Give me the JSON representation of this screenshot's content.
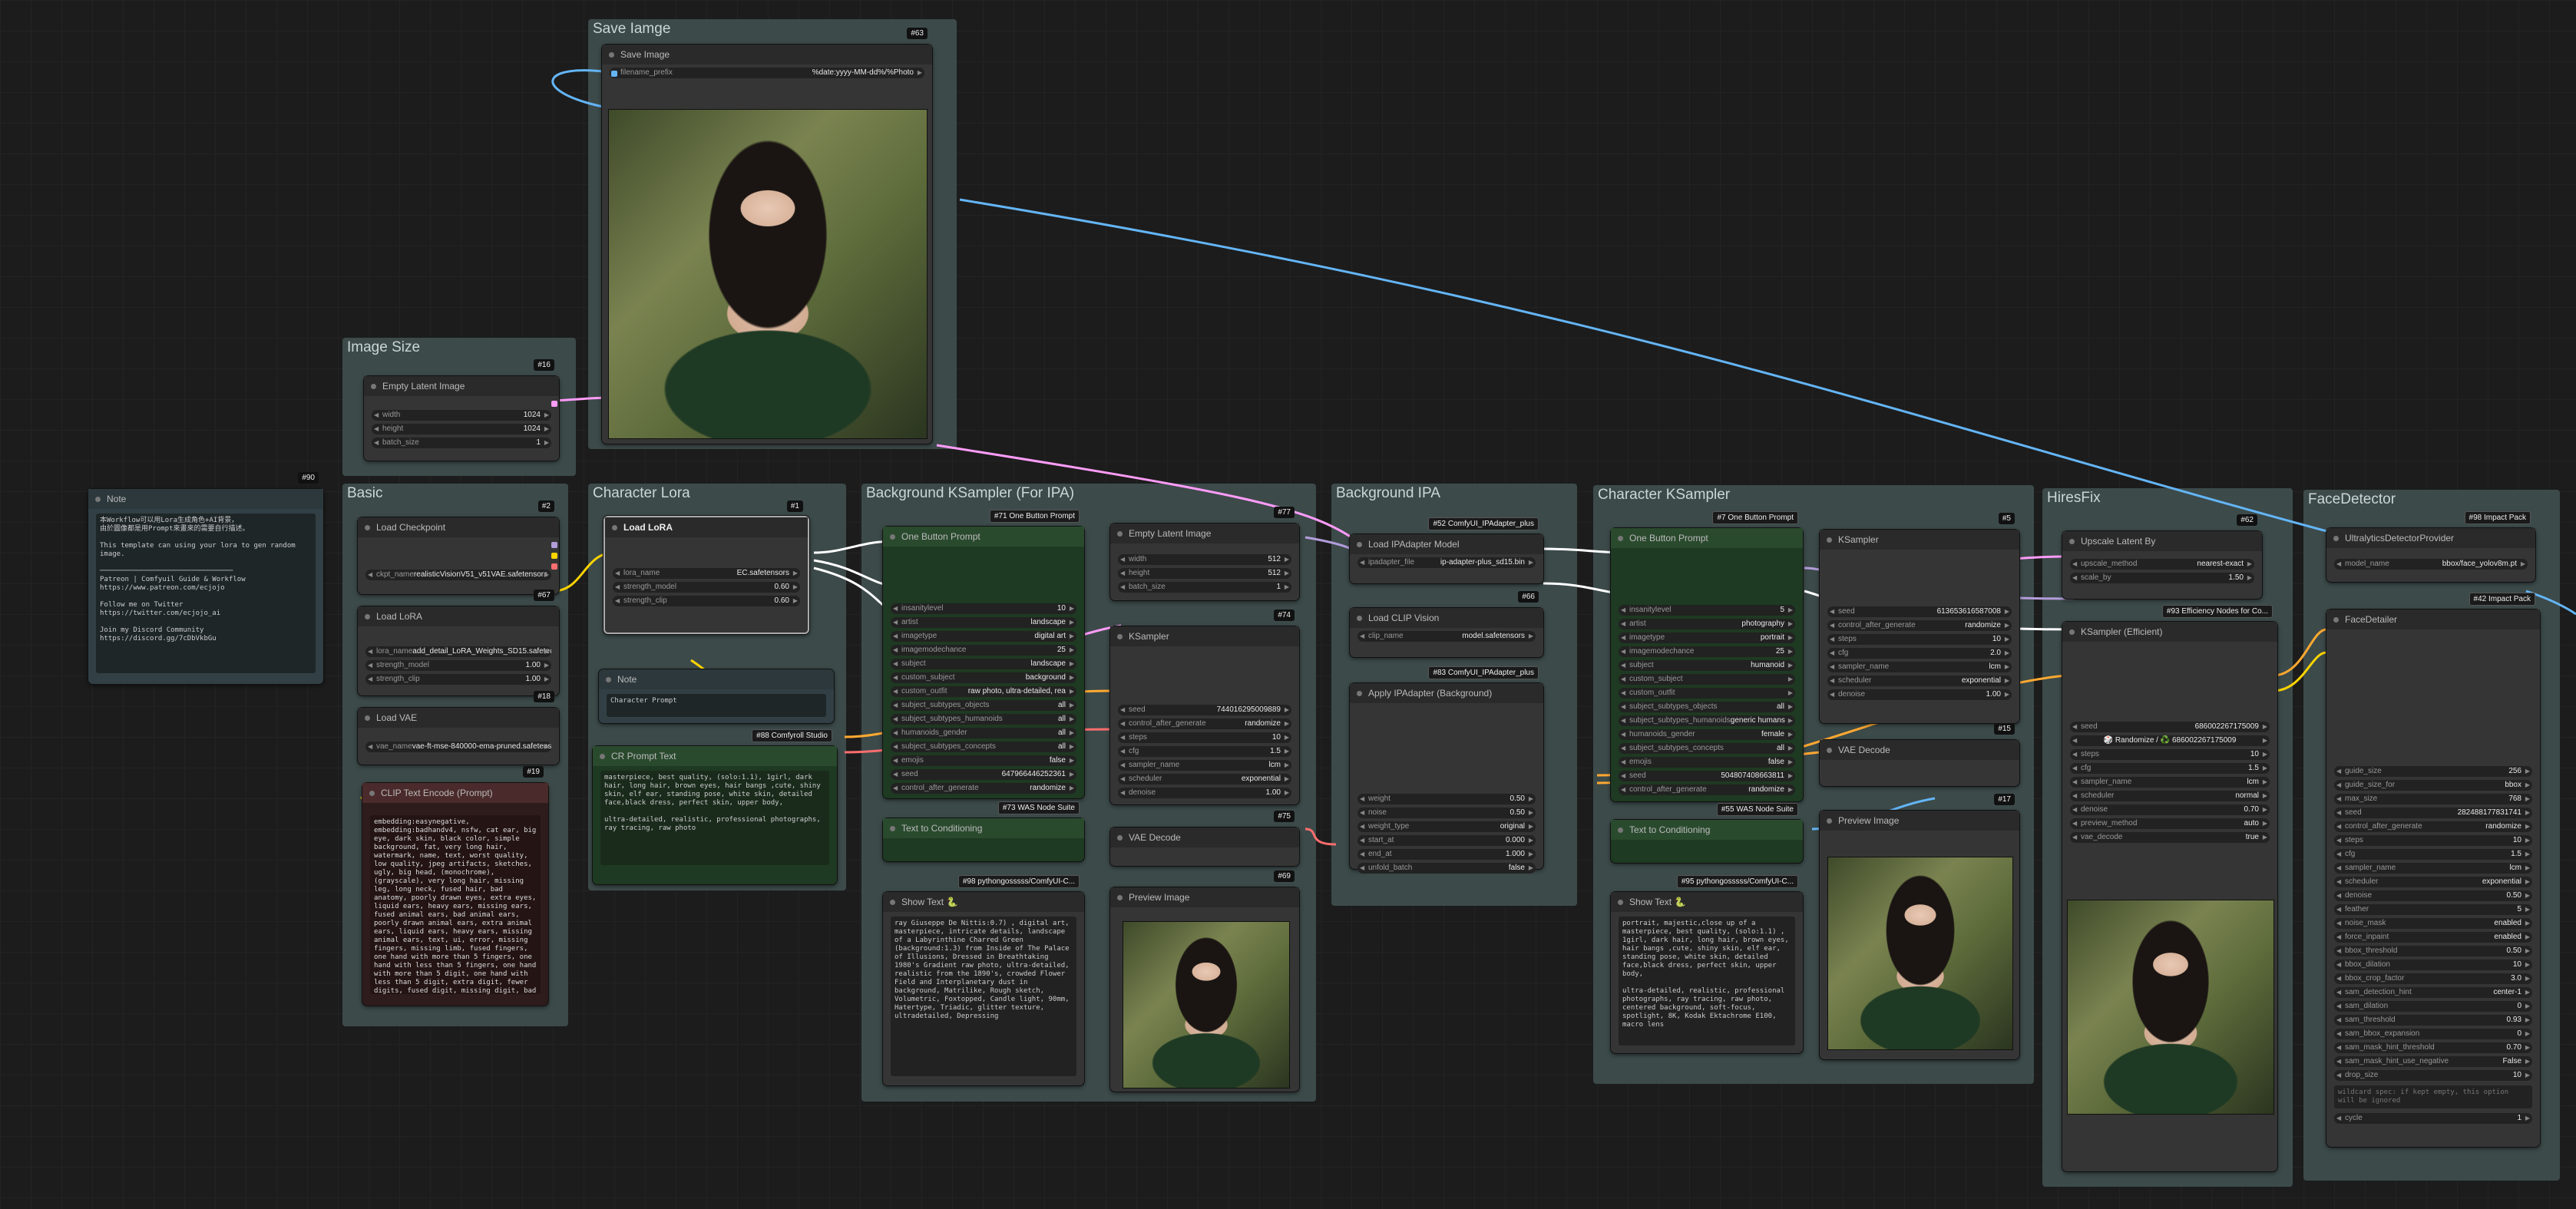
{
  "groups": {
    "save_image": "Save Iamge",
    "image_size": "Image Size",
    "basic": "Basic",
    "character_lora": "Character Lora",
    "bg_ksampler": "Background KSampler (For IPA)",
    "bg_ipa": "Background IPA",
    "char_ksampler": "Character KSampler",
    "hiresfix": "HiresFix",
    "facedetector": "FaceDetector"
  },
  "save_image_node": {
    "title": "Save Image",
    "badge": "#63",
    "filename_label": "filename_prefix",
    "filename_value": "%date:yyyy-MM-dd%/%Photo"
  },
  "empty_latent_1": {
    "title": "Empty Latent Image",
    "badge": "#16",
    "width_label": "width",
    "width": "1024",
    "height_label": "height",
    "height": "1024",
    "batch_label": "batch_size",
    "batch": "1"
  },
  "note_main": {
    "title": "Note",
    "badge": "#90",
    "text": "本Workflow可以用Lora生成角色+AI背景，\n由於圖像都是用Prompt來畫來的需要自行描述。\n\nThis template can using your lora to gen random image.\n\n────────────────────────────────\nPatreon | Comfyuil Guide & Workflow\nhttps://www.patreon.com/ecjojo\n\nFollow me on Twitter\nhttps://twitter.com/ecjojo_ai\n\nJoin my Discord Community\nhttps://discord.gg/7cDbVkbGu"
  },
  "load_checkpoint": {
    "title": "Load Checkpoint",
    "badge": "#2",
    "ckpt_label": "ckpt_name",
    "ckpt": "realisticVisionV51_v51VAE.safetensors"
  },
  "load_lora_basic": {
    "title": "Load LoRA",
    "badge": "#67",
    "lora_label": "lora_name",
    "lora": "add_detail_LoRA_Weights_SD15.safetensors",
    "sm_label": "strength_model",
    "sm": "1.00",
    "sc_label": "strength_clip",
    "sc": "1.00"
  },
  "load_vae": {
    "title": "Load VAE",
    "badge": "#18",
    "vae_label": "vae_name",
    "vae": "vae-ft-mse-840000-ema-pruned.safetensors"
  },
  "clip_text_encode": {
    "title": "CLIP Text Encode (Prompt)",
    "badge": "#19",
    "text": "embedding:easynegative, embedding:badhandv4, nsfw, cat ear, big eye, dark skin, black color, simple background, fat, very long hair, watermark, name, text, worst quality, low quality, jpeg artifacts, sketches, ugly, big head, (monochrome), (grayscale), very long hair, missing leg, long neck, fused hair, bad anatomy, poorly drawn eyes, extra eyes, liquid ears, heavy ears, missing ears, fused animal ears, bad animal ears, poorly drawn animal ears, extra animal ears, liquid ears, heavy ears, missing animal ears, text, ui, error, missing fingers, missing limb, fused fingers, one hand with more than 5 fingers, one hand with less than 5 fingers, one hand with more than 5 digit, one hand with less than 5 digit, extra digit, fewer digits, fused digit, missing digit, bad digit, liquid digit, colorful tongue, black tongue, cropped, watermark, username, blurry, JPEG artifacts, signature, 3D, 3D game, 3D game scene, 3D character, malformed feet, extra feet, bad feet, poorly drawn feet, fused feet, missing feet, extra shoes, bad shoes, fused shoes, more than two shoes, poorly drawn shoes, bad gloves, poorly drawn gloves, fused gloves, bad cum, poorly drawn cum, fused cum, bad hairs, poorly drawn hairs, fused hairs, big muscles, ugly, bad face, fused face, poorly drawn face, cloned face, big face, long face, bad eyes, fused eyes poorly drawn eyes, extra eyes, malformed limbs, more than 2 nipples, missing nipples, different nipples, fused nipples, bad nipples, poorly drawn nipples, black nipples, colorful nipples, gross proportions, short arm, (((missing arms))), missing thighs, missing calf, missing legs, mutation, duplicate, morbid, mutilated, poorly drawn hands, more than 1 left hand, more than 1 right hand, deformed, (blurry), disfigured, missing legs, extra arms, extra thighs, more than 2 thighs, extra calf, fused calf, extra legs, bad knee, extra knee, more than 2 legs, bad tails, bad mouth, fused mouth, poorly drawn mouth, bad tongue, tongue within mouth, too long tongue, black tongue, big mouth, cracked mouth, bad mouth, dirty face, dirty teeth, dirty pantie, fused pantie, poorly drawn pantie, fused cloth, poorly drawn cloth, bad pantie, yellow teeth, thick lips, bad cameltoe, colorful cameltoe, bad asshole, poorly drawn asshole, fused asshole, missing asshole, bad anus, bad pussy, bad crotch, bad crotch seam, fused anus, fused pussy, fused anus, fused crotch, poorly drawn crotch, fused seam, poorly drawn anus, poorly drawn pussy, poorly drawn crotch, poorly drawn crotch seam, bad thigh gap, missing thigh gap, fused thigh gap, liquid thigh gap, poorly drawn thigh gap, poorly drawn anus, bad collarbone, fused collarbone, missing collarbone, liquid collarbone, strong girl, obesity, worst quality, low quality, normal quality, liquid tentacles, bad tentacles, poorly drawn tentacles, split tentacles, fused tentacles, missing clit, bad clit, fused clit, colorful clit, black clit, liquid clit, QR code, bar code, censored, safety panties, safety knickers, beard, furry, pony, pubic hair, mosaic, futa, testis, (((nsfw)))"
  },
  "load_lora_char": {
    "title": "Load LoRA",
    "badge": "#1",
    "lora_label": "lora_name",
    "lora": "EC.safetensors",
    "sm_label": "strength_model",
    "sm": "0.60",
    "sc_label": "strength_clip",
    "sc": "0.60"
  },
  "note_char": {
    "title": "Note",
    "text": "Character Prompt"
  },
  "cr_prompt": {
    "title": "CR Prompt Text",
    "badge": "#88 Comfyroll Studio",
    "text": "masterpiece, best quality, (solo:1.1), 1girl, dark hair, long hair, brown eyes, hair bangs ,cute, shiny skin, elf ear, standing pose, white skin, detailed face,black dress, perfect skin, upper body,\n\nultra-detailed, realistic, professional photographs, ray tracing, raw photo"
  },
  "one_button_bg": {
    "title": "One Button Prompt",
    "badge": "#71 One Button Prompt",
    "rows": [
      [
        "insanitylevel",
        "10"
      ],
      [
        "artist",
        "landscape"
      ],
      [
        "imagetype",
        "digital art"
      ],
      [
        "imagemodechance",
        "25"
      ],
      [
        "subject",
        "landscape"
      ],
      [
        "custom_subject",
        "background"
      ],
      [
        "custom_outfit",
        "raw photo, ultra-detailed, rea"
      ],
      [
        "subject_subtypes_objects",
        "all"
      ],
      [
        "subject_subtypes_humanoids",
        "all"
      ],
      [
        "humanoids_gender",
        "all"
      ],
      [
        "subject_subtypes_concepts",
        "all"
      ],
      [
        "emojis",
        "false"
      ],
      [
        "seed",
        "647966446252361"
      ],
      [
        "control_after_generate",
        "randomize"
      ]
    ]
  },
  "text_concat_bg": {
    "title": "Text to Conditioning",
    "badge": "#73 WAS Node Suite"
  },
  "show_text_bg": {
    "title": "Show Text 🐍",
    "badge": "#98 pythongosssss/ComfyUI-C...",
    "text": "ray Giuseppe De Nittis:0.7) , digital art, masterpiece, intricate details, landscape of a Labyrinthine Charred Green (background:1.3) from Inside of The Palace of Illusions, Dressed in Breathtaking 1980's Gradient raw photo, ultra-detailed, realistic from the 1890's, crowded Flower Field and Interplanetary dust in background, Matrilike, Rough sketch, Volumetric, Foxtopped, Candle light, 90mm, Hatertype, Triadic, glitter texture, ultradetailed, Depressing"
  },
  "empty_latent_bg": {
    "title": "Empty Latent Image",
    "badge": "#77",
    "width_label": "width",
    "width": "512",
    "height_label": "height",
    "height": "512",
    "batch_label": "batch_size",
    "batch": "1"
  },
  "ksampler_bg": {
    "title": "KSampler",
    "badge": "#74",
    "rows": [
      [
        "seed",
        "744016295009889"
      ],
      [
        "control_after_generate",
        "randomize"
      ],
      [
        "steps",
        "10"
      ],
      [
        "cfg",
        "1.5"
      ],
      [
        "sampler_name",
        "lcm"
      ],
      [
        "scheduler",
        "exponential"
      ],
      [
        "denoise",
        "1.00"
      ]
    ]
  },
  "vae_decode_bg": {
    "title": "VAE Decode",
    "badge": "#75"
  },
  "preview_bg": {
    "title": "Preview Image",
    "badge": "#69"
  },
  "load_ipa_model": {
    "title": "Load IPAdapter Model",
    "badge": "#52 ComfyUI_IPAdapter_plus",
    "label": "ipadapter_file",
    "value": "ip-adapter-plus_sd15.bin"
  },
  "load_clip_vision": {
    "title": "Load CLIP Vision",
    "badge": "#66",
    "label": "clip_name",
    "value": "model.safetensors"
  },
  "apply_ipa": {
    "title": "Apply IPAdapter (Background)",
    "badge": "#83 ComfyUI_IPAdapter_plus",
    "rows": [
      [
        "weight",
        "0.50"
      ],
      [
        "noise",
        "0.50"
      ],
      [
        "weight_type",
        "original"
      ],
      [
        "start_at",
        "0.000"
      ],
      [
        "end_at",
        "1.000"
      ],
      [
        "unfold_batch",
        "false"
      ]
    ]
  },
  "one_button_char": {
    "title": "One Button Prompt",
    "badge": "#7 One Button Prompt",
    "rows": [
      [
        "insanitylevel",
        "5"
      ],
      [
        "artist",
        "photography"
      ],
      [
        "imagetype",
        "portrait"
      ],
      [
        "imagemodechance",
        "25"
      ],
      [
        "subject",
        "humanoid"
      ],
      [
        "custom_subject",
        ""
      ],
      [
        "custom_outfit",
        ""
      ],
      [
        "subject_subtypes_objects",
        "all"
      ],
      [
        "subject_subtypes_humanoids",
        "generic humans"
      ],
      [
        "humanoids_gender",
        "female"
      ],
      [
        "subject_subtypes_concepts",
        "all"
      ],
      [
        "emojis",
        "false"
      ],
      [
        "seed",
        "504807408663811"
      ],
      [
        "control_after_generate",
        "randomize"
      ]
    ]
  },
  "text_concat_char": {
    "title": "Text to Conditioning",
    "badge": "#55 WAS Node Suite"
  },
  "show_text_char": {
    "title": "Show Text 🐍",
    "badge": "#95 pythongosssss/ComfyUI-C...",
    "text": "portrait, majestic,close up of a masterpiece, best quality, (solo:1.1) , 1girl, dark hair, long hair, brown eyes, hair bangs ,cute, shiny skin, elf ear, standing pose, white skin, detailed face,black dress, perfect skin, upper body,\n\nultra-detailed, realistic, professional photographs, ray tracing, raw photo, centered background, soft-focus, spotlight, 8K, Kodak Ektachrome E100, macro lens"
  },
  "ksampler_char": {
    "title": "KSampler",
    "badge": "#5",
    "rows": [
      [
        "seed",
        "613653616587008"
      ],
      [
        "control_after_generate",
        "randomize"
      ],
      [
        "steps",
        "10"
      ],
      [
        "cfg",
        "2.0"
      ],
      [
        "sampler_name",
        "lcm"
      ],
      [
        "scheduler",
        "exponential"
      ],
      [
        "denoise",
        "1.00"
      ]
    ]
  },
  "vae_decode_char": {
    "title": "VAE Decode",
    "badge": "#15"
  },
  "preview_char": {
    "title": "Preview Image",
    "badge": "#17"
  },
  "upscale_latent": {
    "title": "Upscale Latent By",
    "badge": "#62",
    "rows": [
      [
        "upscale_method",
        "nearest-exact"
      ],
      [
        "scale_by",
        "1.50"
      ]
    ]
  },
  "ksampler_eff": {
    "title": "KSampler (Efficient)",
    "badge": "#93 Efficiency Nodes for Co...",
    "seed_label": "seed",
    "seed": "686002267175009",
    "randomize": "🎲 Randomize / ♻️ 686002267175009",
    "rows": [
      [
        "steps",
        "10"
      ],
      [
        "cfg",
        "1.5"
      ],
      [
        "sampler_name",
        "lcm"
      ],
      [
        "scheduler",
        "normal"
      ],
      [
        "denoise",
        "0.70"
      ],
      [
        "preview_method",
        "auto"
      ],
      [
        "vae_decode",
        "true"
      ]
    ]
  },
  "ultralytics": {
    "title": "UltralyticsDetectorProvider",
    "badge": "#98 Impact Pack",
    "label": "model_name",
    "value": "bbox/face_yolov8m.pt"
  },
  "facedetailer": {
    "title": "FaceDetailer",
    "badge": "#42 Impact Pack",
    "rows": [
      [
        "guide_size",
        "256"
      ],
      [
        "guide_size_for",
        "bbox"
      ],
      [
        "max_size",
        "768"
      ],
      [
        "seed",
        "282488177831741"
      ],
      [
        "control_after_generate",
        "randomize"
      ],
      [
        "steps",
        "10"
      ],
      [
        "cfg",
        "1.5"
      ],
      [
        "sampler_name",
        "lcm"
      ],
      [
        "scheduler",
        "exponential"
      ],
      [
        "denoise",
        "0.50"
      ],
      [
        "feather",
        "5"
      ],
      [
        "noise_mask",
        "enabled"
      ],
      [
        "force_inpaint",
        "enabled"
      ],
      [
        "bbox_threshold",
        "0.50"
      ],
      [
        "bbox_dilation",
        "10"
      ],
      [
        "bbox_crop_factor",
        "3.0"
      ],
      [
        "sam_detection_hint",
        "center-1"
      ],
      [
        "sam_dilation",
        "0"
      ],
      [
        "sam_threshold",
        "0.93"
      ],
      [
        "sam_bbox_expansion",
        "0"
      ],
      [
        "sam_mask_hint_threshold",
        "0.70"
      ],
      [
        "sam_mask_hint_use_negative",
        "False"
      ],
      [
        "drop_size",
        "10"
      ]
    ],
    "wildcard_placeholder": "wildcard spec: if kept empty, this option will be ignored",
    "cycle_label": "cycle",
    "cycle": "1"
  },
  "colors": {
    "model": "#b39ddb",
    "clip": "#ffd500",
    "vae": "#ff6e6e",
    "latent": "#ff9cf9",
    "image": "#64b5f6",
    "conditioning": "#ffa931",
    "string": "#8fd18f"
  }
}
